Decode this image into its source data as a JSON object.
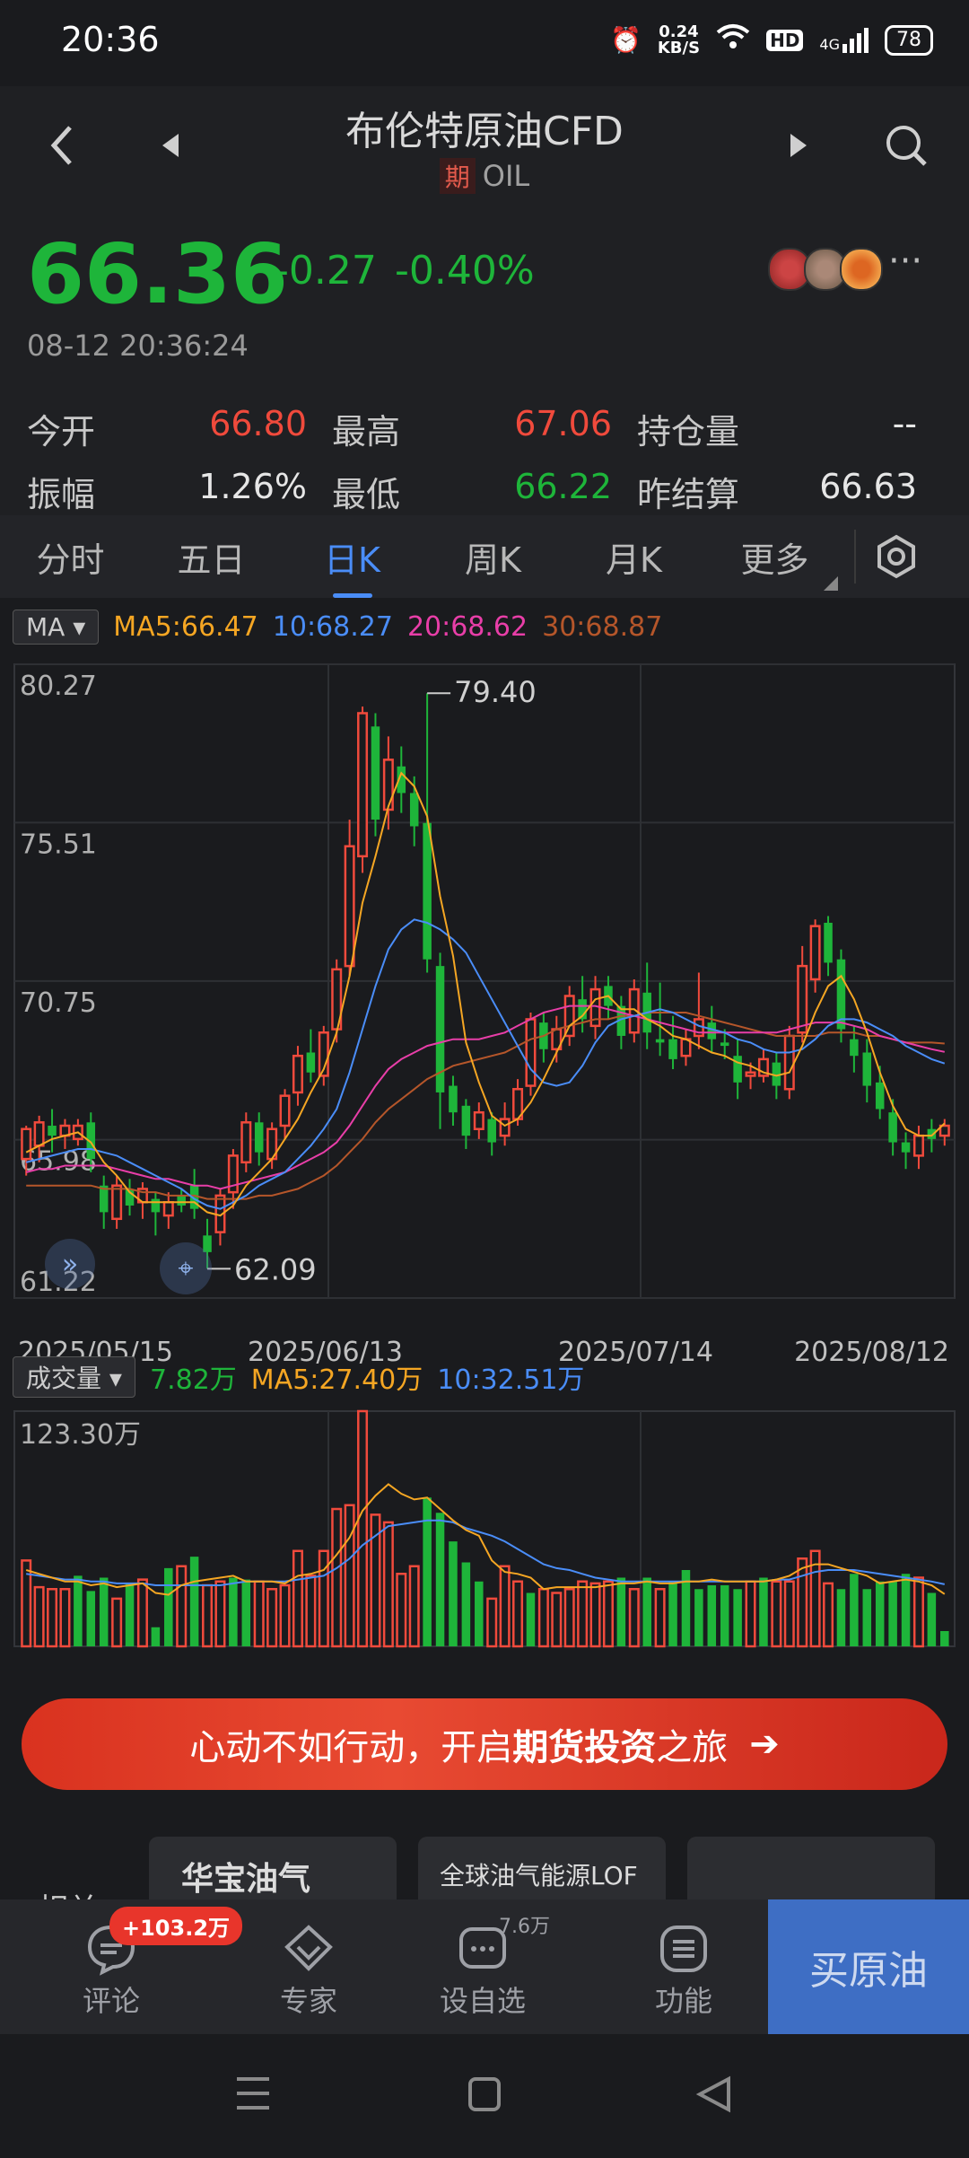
{
  "status": {
    "time": "20:36",
    "net_speed_top": "0.24",
    "net_speed_bottom": "KB/S",
    "battery": "78",
    "hd": "HD",
    "signal_label": "4G"
  },
  "header": {
    "title": "布伦特原油CFD",
    "tag": "期",
    "code": "OIL"
  },
  "quote": {
    "price": "66.36",
    "change": "-0.27",
    "change_pct": "-0.40%",
    "timestamp": "08-12 20:36:24",
    "stats": [
      {
        "label": "今开",
        "value": "66.80",
        "color": "red"
      },
      {
        "label": "最高",
        "value": "67.06",
        "color": "red"
      },
      {
        "label": "持仓量",
        "value": "--",
        "color": "wht"
      },
      {
        "label": "振幅",
        "value": "1.26%",
        "color": "wht"
      },
      {
        "label": "最低",
        "value": "66.22",
        "color": "green"
      },
      {
        "label": "昨结算",
        "value": "66.63",
        "color": "wht"
      }
    ]
  },
  "tabs": [
    "分时",
    "五日",
    "日K",
    "周K",
    "月K",
    "更多"
  ],
  "active_tab": 2,
  "indicators": {
    "ma_select": "MA",
    "ma5": "MA5:66.47",
    "ma10": "10:68.27",
    "ma20": "20:68.62",
    "ma30": "30:68.87",
    "vol_select": "成交量",
    "vol_now": "7.82万",
    "vol_ma5": "MA5:27.40万",
    "vol_ma10": "10:32.51万"
  },
  "colors": {
    "up": "#f04a3c",
    "down": "#1eb53a",
    "ma5": "#f5a623",
    "ma10": "#4a8df8",
    "ma20": "#e83ea8",
    "ma30": "#b5562a"
  },
  "chart_data": {
    "type": "candlestick",
    "y_ticks": [
      "80.27",
      "75.51",
      "70.75",
      "65.98",
      "61.22"
    ],
    "ylim": [
      61.22,
      80.27
    ],
    "x_ticks": [
      "2025/05/15",
      "2025/06/13",
      "2025/07/14",
      "2025/08/12"
    ],
    "max_label": "79.40",
    "min_label": "62.09",
    "candles": [
      [
        65.4,
        66.3,
        64.9,
        66.4
      ],
      [
        65.8,
        66.5,
        65.3,
        66.7
      ],
      [
        66.4,
        66.1,
        65.6,
        66.9
      ],
      [
        66.1,
        66.4,
        65.7,
        66.6
      ],
      [
        66.0,
        66.4,
        65.8,
        66.6
      ],
      [
        66.5,
        65.4,
        65.0,
        66.8
      ],
      [
        64.6,
        63.8,
        63.3,
        64.9
      ],
      [
        63.6,
        64.6,
        63.3,
        64.9
      ],
      [
        64.5,
        64.0,
        63.7,
        64.8
      ],
      [
        64.1,
        64.5,
        63.6,
        64.7
      ],
      [
        64.2,
        63.8,
        63.1,
        64.4
      ],
      [
        63.7,
        64.1,
        63.3,
        64.4
      ],
      [
        64.3,
        64.0,
        63.8,
        64.5
      ],
      [
        64.6,
        63.9,
        63.6,
        65.1
      ],
      [
        63.1,
        62.6,
        62.1,
        63.6
      ],
      [
        63.2,
        64.3,
        62.8,
        64.5
      ],
      [
        64.4,
        65.5,
        63.9,
        65.7
      ],
      [
        65.3,
        66.5,
        65.0,
        66.8
      ],
      [
        66.5,
        65.6,
        65.2,
        66.8
      ],
      [
        65.4,
        66.3,
        65.1,
        66.5
      ],
      [
        66.4,
        67.3,
        66.0,
        67.5
      ],
      [
        67.4,
        68.5,
        67.0,
        68.8
      ],
      [
        68.6,
        68.0,
        67.7,
        69.3
      ],
      [
        67.9,
        69.2,
        67.6,
        69.4
      ],
      [
        69.3,
        71.1,
        68.9,
        71.4
      ],
      [
        71.2,
        74.8,
        70.9,
        75.6
      ],
      [
        74.5,
        78.8,
        74.0,
        79.0
      ],
      [
        78.4,
        75.6,
        75.1,
        78.8
      ],
      [
        75.9,
        77.4,
        75.3,
        78.1
      ],
      [
        77.2,
        76.4,
        75.8,
        77.8
      ],
      [
        76.4,
        75.4,
        74.8,
        76.9
      ],
      [
        75.5,
        71.4,
        71.0,
        79.4
      ],
      [
        71.2,
        67.4,
        66.3,
        71.6
      ],
      [
        67.6,
        66.8,
        66.4,
        67.9
      ],
      [
        67.0,
        66.1,
        65.7,
        67.2
      ],
      [
        66.3,
        66.8,
        66.0,
        67.1
      ],
      [
        66.6,
        65.9,
        65.5,
        66.8
      ],
      [
        66.1,
        66.6,
        65.8,
        67.1
      ],
      [
        66.6,
        67.5,
        66.4,
        67.8
      ],
      [
        67.6,
        69.6,
        67.3,
        69.8
      ],
      [
        69.5,
        68.7,
        68.3,
        69.8
      ],
      [
        68.7,
        69.3,
        68.3,
        69.7
      ],
      [
        69.1,
        70.3,
        68.8,
        70.6
      ],
      [
        70.2,
        69.6,
        69.2,
        70.9
      ],
      [
        69.4,
        70.5,
        69.0,
        70.9
      ],
      [
        70.6,
        70.0,
        69.6,
        70.9
      ],
      [
        70.0,
        69.1,
        68.7,
        70.3
      ],
      [
        69.2,
        70.5,
        68.9,
        70.8
      ],
      [
        70.4,
        69.2,
        68.7,
        71.3
      ],
      [
        69.0,
        68.9,
        68.5,
        70.7
      ],
      [
        69.0,
        68.4,
        68.1,
        69.7
      ],
      [
        68.5,
        69.0,
        68.2,
        69.3
      ],
      [
        69.1,
        69.6,
        68.7,
        71.0
      ],
      [
        69.5,
        69.0,
        68.6,
        70.0
      ],
      [
        68.9,
        68.8,
        68.4,
        69.3
      ],
      [
        68.5,
        67.7,
        67.2,
        69.0
      ],
      [
        67.9,
        68.0,
        67.5,
        68.3
      ],
      [
        67.9,
        68.4,
        67.7,
        68.7
      ],
      [
        68.3,
        67.6,
        67.2,
        68.6
      ],
      [
        67.5,
        69.1,
        67.2,
        69.4
      ],
      [
        69.2,
        71.2,
        68.9,
        71.8
      ],
      [
        70.8,
        72.4,
        70.4,
        72.6
      ],
      [
        72.5,
        71.3,
        70.9,
        72.7
      ],
      [
        71.4,
        69.3,
        68.9,
        71.7
      ],
      [
        69.0,
        68.5,
        68.0,
        69.4
      ],
      [
        68.6,
        67.6,
        67.1,
        69.0
      ],
      [
        67.7,
        66.9,
        66.6,
        68.2
      ],
      [
        66.8,
        65.9,
        65.5,
        67.2
      ],
      [
        65.9,
        65.6,
        65.1,
        66.2
      ],
      [
        65.5,
        66.1,
        65.1,
        66.4
      ],
      [
        66.3,
        66.0,
        65.6,
        66.6
      ],
      [
        66.1,
        66.4,
        65.8,
        66.6
      ]
    ],
    "volume_max_label": "123.30万",
    "volume_max": 123.3,
    "volumes": [
      [
        45,
        "up"
      ],
      [
        31,
        "up"
      ],
      [
        30,
        "up"
      ],
      [
        30,
        "up"
      ],
      [
        37,
        "down"
      ],
      [
        29,
        "down"
      ],
      [
        36,
        "down"
      ],
      [
        25,
        "up"
      ],
      [
        33,
        "down"
      ],
      [
        35,
        "up"
      ],
      [
        10,
        "down"
      ],
      [
        41,
        "down"
      ],
      [
        42,
        "up"
      ],
      [
        47,
        "down"
      ],
      [
        32,
        "up"
      ],
      [
        34,
        "up"
      ],
      [
        36,
        "down"
      ],
      [
        35,
        "down"
      ],
      [
        34,
        "up"
      ],
      [
        30,
        "up"
      ],
      [
        32,
        "up"
      ],
      [
        50,
        "up"
      ],
      [
        37,
        "up"
      ],
      [
        50,
        "up"
      ],
      [
        72,
        "up"
      ],
      [
        74,
        "up"
      ],
      [
        123.3,
        "up"
      ],
      [
        69,
        "up"
      ],
      [
        65,
        "up"
      ],
      [
        38,
        "up"
      ],
      [
        42,
        "up"
      ],
      [
        78,
        "down"
      ],
      [
        70,
        "down"
      ],
      [
        55,
        "down"
      ],
      [
        44,
        "down"
      ],
      [
        34,
        "down"
      ],
      [
        25,
        "up"
      ],
      [
        42,
        "up"
      ],
      [
        34,
        "up"
      ],
      [
        28,
        "down"
      ],
      [
        30,
        "up"
      ],
      [
        28,
        "up"
      ],
      [
        30,
        "up"
      ],
      [
        34,
        "up"
      ],
      [
        33,
        "up"
      ],
      [
        34,
        "up"
      ],
      [
        36,
        "down"
      ],
      [
        30,
        "up"
      ],
      [
        36,
        "down"
      ],
      [
        30,
        "up"
      ],
      [
        34,
        "down"
      ],
      [
        40,
        "down"
      ],
      [
        30,
        "down"
      ],
      [
        32,
        "down"
      ],
      [
        32,
        "down"
      ],
      [
        30,
        "down"
      ],
      [
        34,
        "up"
      ],
      [
        36,
        "down"
      ],
      [
        34,
        "up"
      ],
      [
        34,
        "up"
      ],
      [
        46,
        "up"
      ],
      [
        50,
        "up"
      ],
      [
        33,
        "up"
      ],
      [
        30,
        "down"
      ],
      [
        38,
        "down"
      ],
      [
        30,
        "down"
      ],
      [
        34,
        "down"
      ],
      [
        34,
        "down"
      ],
      [
        38,
        "down"
      ],
      [
        36,
        "up"
      ],
      [
        28,
        "down"
      ],
      [
        8,
        "down"
      ]
    ],
    "ma5": [
      65.6,
      65.8,
      66.0,
      66.1,
      66.2,
      65.9,
      65.3,
      64.9,
      64.4,
      64.1,
      64.1,
      64.1,
      64.1,
      64.1,
      63.8,
      63.7,
      64.0,
      64.6,
      65.0,
      65.4,
      66.0,
      66.6,
      67.4,
      68.1,
      69.2,
      70.9,
      73.1,
      74.5,
      76.0,
      77.0,
      76.6,
      75.7,
      73.3,
      71.5,
      68.9,
      67.7,
      66.7,
      66.4,
      66.6,
      67.1,
      67.8,
      68.6,
      69.4,
      69.7,
      70.2,
      70.3,
      69.9,
      69.9,
      69.6,
      69.4,
      69.1,
      69.0,
      68.8,
      68.6,
      68.5,
      68.3,
      68.2,
      68.0,
      67.9,
      68.0,
      68.8,
      69.8,
      70.6,
      70.9,
      70.2,
      69.2,
      68.0,
      67.0,
      66.3,
      66.1,
      66.1,
      66.47
    ],
    "ma10": [
      65.3,
      65.4,
      65.5,
      65.6,
      65.7,
      65.7,
      65.6,
      65.5,
      65.3,
      65.1,
      64.9,
      64.7,
      64.5,
      64.2,
      64.0,
      63.9,
      64.1,
      64.3,
      64.6,
      64.8,
      65.0,
      65.4,
      65.8,
      66.3,
      66.9,
      68.0,
      69.3,
      70.6,
      71.7,
      72.3,
      72.6,
      72.5,
      72.3,
      72.0,
      71.6,
      70.9,
      70.2,
      69.5,
      68.8,
      68.1,
      67.7,
      67.6,
      67.7,
      68.2,
      68.9,
      69.4,
      69.6,
      69.7,
      69.8,
      69.9,
      69.8,
      69.6,
      69.4,
      69.3,
      69.2,
      69.0,
      68.9,
      68.7,
      68.6,
      68.6,
      68.7,
      69.0,
      69.4,
      69.6,
      69.6,
      69.5,
      69.3,
      69.1,
      68.8,
      68.6,
      68.4,
      68.27
    ],
    "ma20": [
      65.0,
      65.1,
      65.1,
      65.2,
      65.2,
      65.2,
      65.2,
      65.1,
      65.0,
      64.9,
      64.8,
      64.8,
      64.7,
      64.6,
      64.6,
      64.5,
      64.6,
      64.7,
      64.8,
      64.9,
      65.0,
      65.2,
      65.4,
      65.6,
      65.9,
      66.4,
      67.0,
      67.6,
      68.1,
      68.4,
      68.6,
      68.8,
      68.9,
      69.0,
      69.0,
      69.0,
      69.1,
      69.2,
      69.4,
      69.6,
      69.8,
      69.9,
      70.0,
      70.0,
      70.0,
      69.9,
      69.8,
      69.7,
      69.6,
      69.5,
      69.4,
      69.3,
      69.2,
      69.2,
      69.2,
      69.2,
      69.2,
      69.2,
      69.2,
      69.3,
      69.4,
      69.5,
      69.5,
      69.5,
      69.4,
      69.3,
      69.1,
      69.0,
      68.9,
      68.8,
      68.7,
      68.62
    ],
    "ma30": [
      64.6,
      64.6,
      64.6,
      64.6,
      64.6,
      64.6,
      64.5,
      64.5,
      64.5,
      64.4,
      64.4,
      64.3,
      64.3,
      64.3,
      64.2,
      64.2,
      64.2,
      64.2,
      64.3,
      64.3,
      64.4,
      64.5,
      64.7,
      64.9,
      65.2,
      65.6,
      66.0,
      66.5,
      66.9,
      67.2,
      67.5,
      67.8,
      68.0,
      68.2,
      68.3,
      68.4,
      68.5,
      68.6,
      68.8,
      69.0,
      69.1,
      69.3,
      69.4,
      69.5,
      69.6,
      69.6,
      69.7,
      69.7,
      69.8,
      69.8,
      69.8,
      69.8,
      69.7,
      69.6,
      69.5,
      69.4,
      69.3,
      69.2,
      69.1,
      69.1,
      69.1,
      69.1,
      69.2,
      69.2,
      69.2,
      69.1,
      69.1,
      69.0,
      68.9,
      68.9,
      68.9,
      68.87
    ],
    "vol_ma5": [
      40,
      38,
      36,
      34,
      34,
      32,
      33,
      31,
      32,
      33,
      28,
      27,
      32,
      34,
      35,
      36,
      37,
      34,
      34,
      34,
      33,
      37,
      38,
      40,
      48,
      57,
      71,
      79,
      85,
      80,
      77,
      78,
      72,
      66,
      61,
      58,
      45,
      39,
      38,
      36,
      30,
      31,
      31,
      31,
      31,
      32,
      33,
      33,
      34,
      33,
      33,
      34,
      34,
      35,
      34,
      34,
      34,
      34,
      35,
      37,
      41,
      43,
      43,
      41,
      39,
      37,
      33,
      34,
      35,
      34,
      32,
      27.4
    ],
    "vol_ma10": [
      38,
      37,
      36,
      35,
      35,
      34,
      34,
      33,
      33,
      33,
      32,
      32,
      32,
      32,
      32,
      32,
      33,
      34,
      34,
      34,
      34,
      35,
      36,
      37,
      41,
      46,
      53,
      58,
      63,
      64,
      65,
      66,
      66,
      65,
      62,
      60,
      58,
      55,
      51,
      47,
      43,
      41,
      40,
      38,
      36,
      35,
      34,
      34,
      34,
      34,
      34,
      34,
      34,
      34,
      34,
      34,
      34,
      34,
      35,
      35,
      37,
      39,
      40,
      40,
      40,
      39,
      38,
      37,
      36,
      35,
      34,
      32.51
    ]
  },
  "banner": {
    "prefix": "心动不如行动，开启",
    "bold": "期货投资",
    "suffix": "之旅",
    "arrow": "➔"
  },
  "cards": [
    {
      "label": "华宝油气LOF"
    },
    {
      "label": "全球油气能源LOF"
    },
    {
      "label": ""
    }
  ],
  "bottomnav": {
    "items": [
      {
        "label": "评论",
        "badge": "+103.2万"
      },
      {
        "label": "专家"
      },
      {
        "label": "设自选",
        "count": "7.6万"
      },
      {
        "label": "功能"
      }
    ],
    "buy": "买原油",
    "cut_text": "相关"
  }
}
